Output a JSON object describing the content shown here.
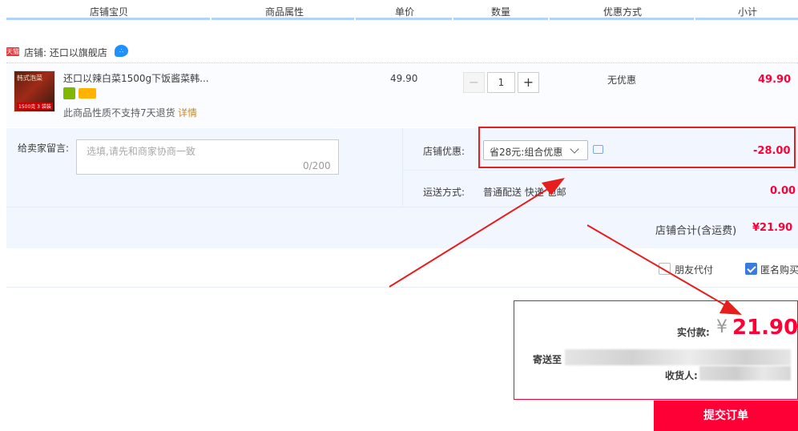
{
  "table_header": {
    "col_item": "店铺宝贝",
    "col_attrs": "商品属性",
    "col_price": "单价",
    "col_qty": "数量",
    "col_discount": "优惠方式",
    "col_subtotal": "小计"
  },
  "shop": {
    "badge": "天猫",
    "label": "店铺: 还口以旗舰店"
  },
  "item": {
    "image_text_top": "韩式泡菜",
    "image_text_bottom": "1500克 3 袋装",
    "title": "还口以辣白菜1500g下饭酱菜韩...",
    "note": "此商品性质不支持7天退货",
    "note_link": "详情",
    "unit_price": "49.90",
    "quantity": "1",
    "minus": "−",
    "plus": "+",
    "discount": "无优惠",
    "subtotal": "49.90"
  },
  "message": {
    "label": "给卖家留言:",
    "placeholder": "选填,请先和商家协商一致",
    "count": "0/200"
  },
  "promo": {
    "label": "店铺优惠:",
    "selected": "省28元:组合优惠",
    "amount": "-28.00"
  },
  "shipping": {
    "label": "运送方式:",
    "value": "普通配送 快递 包邮",
    "amount": "0.00"
  },
  "shop_total": {
    "label": "店铺合计(含运费)",
    "amount": "¥21.90"
  },
  "options": {
    "friend_pay": "朋友代付",
    "anonymous": "匿名购买"
  },
  "payment": {
    "label": "实付款:",
    "yen": "¥",
    "amount": "21.90",
    "ship_to_label": "寄送至",
    "receiver_label": "收货人:"
  },
  "submit_label": "提交订单",
  "colors": {
    "accent_red": "#ff0036",
    "annotation_red": "#e61e1e",
    "header_line": "#b2d1ff"
  }
}
